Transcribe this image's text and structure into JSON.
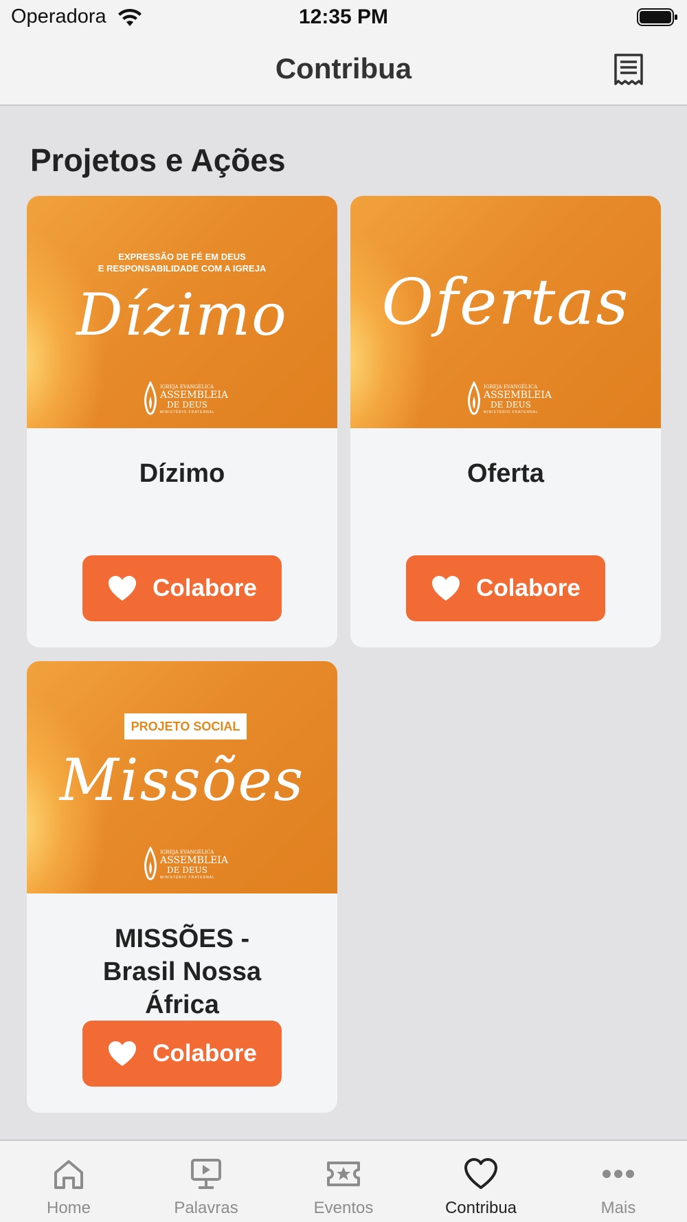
{
  "status_bar": {
    "carrier": "Operadora",
    "time": "12:35 PM"
  },
  "nav": {
    "title": "Contribua",
    "receipt_icon": "receipt-icon"
  },
  "section": {
    "title": "Projetos e Ações"
  },
  "colors": {
    "accent": "#f26b35",
    "card_bg": "#f4f5f7",
    "page_bg": "#e2e2e5",
    "image_orange": "#e78a2a"
  },
  "cards": [
    {
      "name": "Dízimo",
      "image_top_text": "EXPRESSÃO DE FÉ EM DEUS\nE RESPONSABILIDADE COM A IGREJA",
      "image_script": "Dízimo",
      "button": "Colabore"
    },
    {
      "name": "Oferta",
      "image_script": "Ofertas",
      "button": "Colabore"
    },
    {
      "name": "MISSÕES - Brasil Nossa África",
      "image_badge": "PROJETO SOCIAL",
      "image_script": "Missões",
      "button": "Colabore"
    }
  ],
  "logo": {
    "line1": "IGREJA EVANGÉLICA",
    "line2": "ASSEMBLEIA",
    "line3": "DE DEUS",
    "line4": "MINISTÉRIO FRATERNAL"
  },
  "tabs": [
    {
      "label": "Home",
      "icon": "home-icon",
      "active": false
    },
    {
      "label": "Palavras",
      "icon": "presentation-icon",
      "active": false
    },
    {
      "label": "Eventos",
      "icon": "ticket-icon",
      "active": false
    },
    {
      "label": "Contribua",
      "icon": "heart-icon",
      "active": true
    },
    {
      "label": "Mais",
      "icon": "more-icon",
      "active": false
    }
  ]
}
